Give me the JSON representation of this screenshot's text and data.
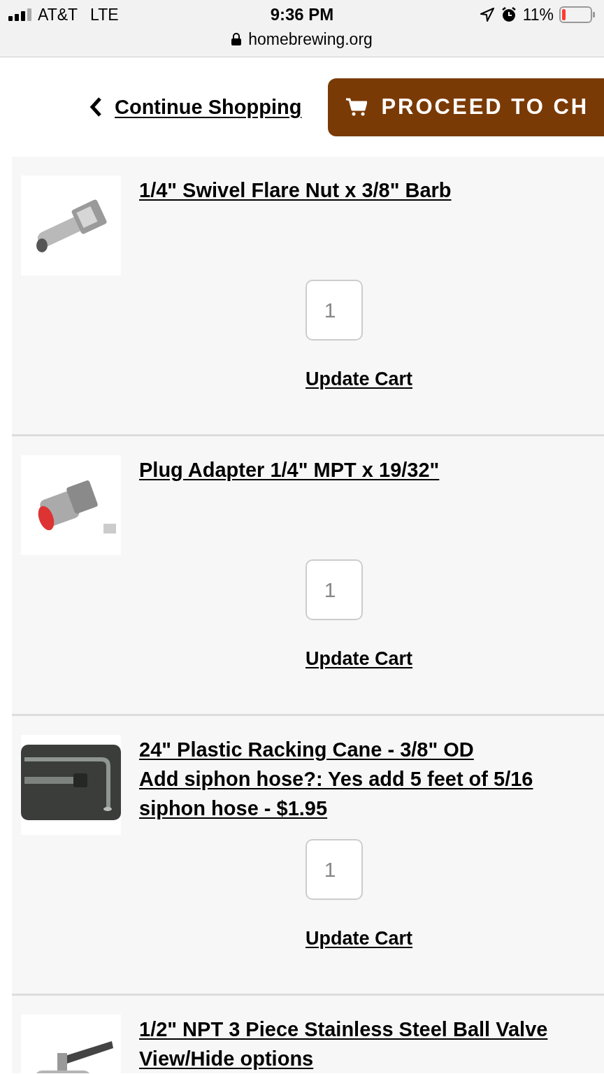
{
  "status_bar": {
    "carrier": "AT&T",
    "network": "LTE",
    "time": "9:36 PM",
    "battery_percent": "11%"
  },
  "address_bar": {
    "url": "homebrewing.org"
  },
  "header": {
    "continue_link": "Continue Shopping",
    "checkout_button": "PROCEED TO CH"
  },
  "cart_items": [
    {
      "kind": "picture",
      "lines": [
        "1/4\" Swivel Flare Nut x 3/8\" Barb"
      ],
      "quantity": "1",
      "update_link": "Update Cart"
    },
    {
      "kind": "picture",
      "lines": [
        "Plug Adapter 1/4\" MPT x 19/32\""
      ],
      "quantity": "1",
      "update_link": "Update Cart"
    },
    {
      "kind": "picture",
      "lines": [
        "24\" Plastic Racking Cane - 3/8\" OD",
        "Add siphon hose?: Yes add 5 feet of 5/16 siphon hose - $1.95"
      ],
      "quantity": "1",
      "update_link": "Update Cart"
    },
    {
      "kind": "picture",
      "lines": [
        "1/2\" NPT 3 Piece Stainless Steel Ball Valve ",
        "View/Hide options"
      ]
    }
  ]
}
